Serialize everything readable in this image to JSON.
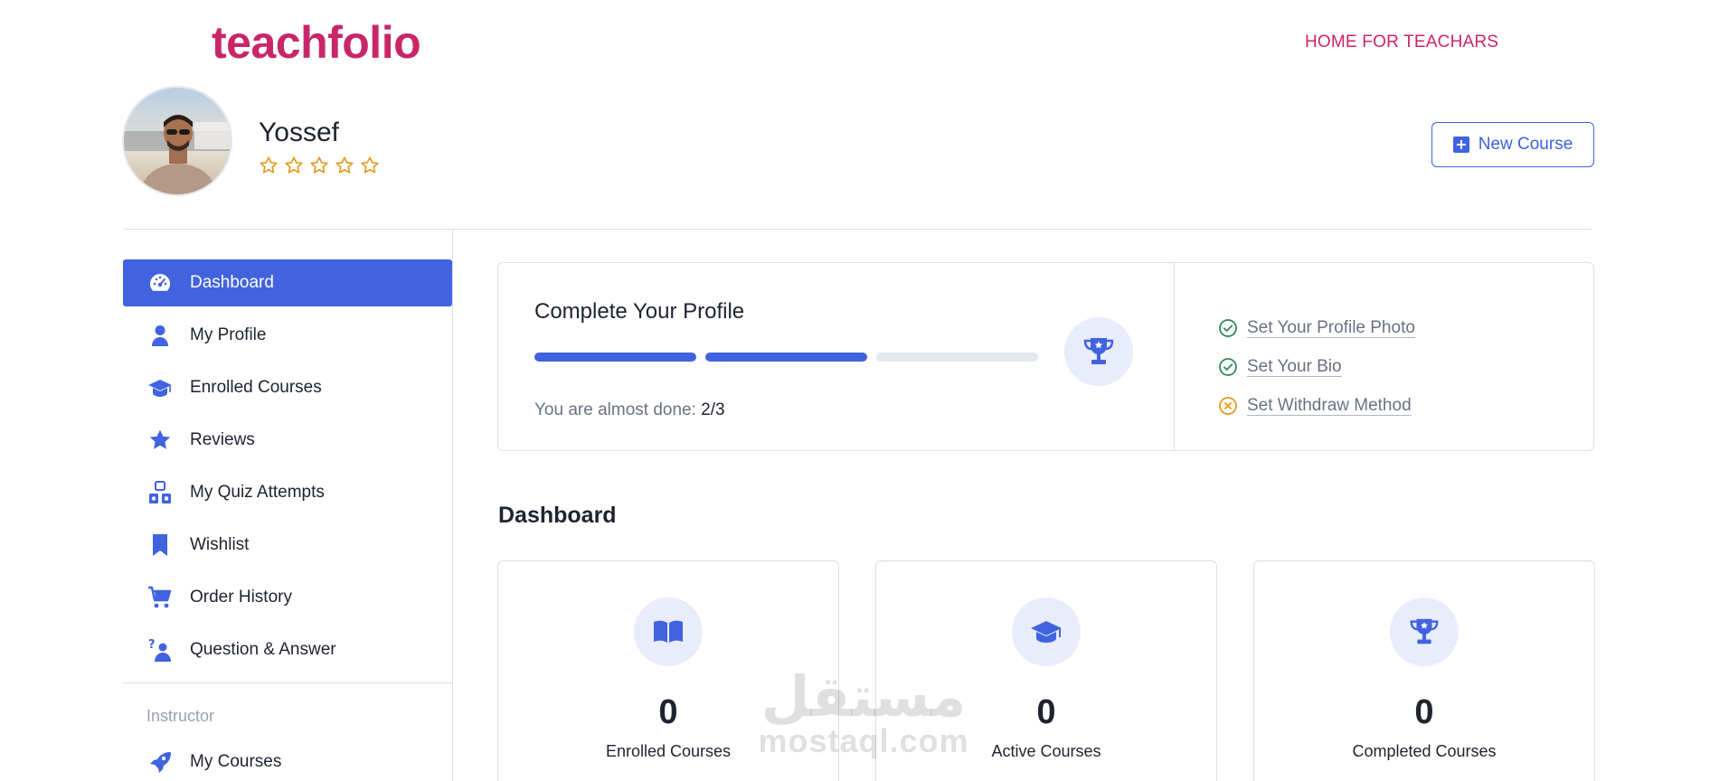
{
  "header": {
    "brand": "teachfolio",
    "top_link": "HOME FOR TEACHARS",
    "new_course_label": "New Course"
  },
  "user": {
    "name": "Yossef",
    "rating_stars": 5,
    "rating_filled": 0
  },
  "sidebar": {
    "items": [
      {
        "label": "Dashboard",
        "icon": "dashboard-gauge-icon",
        "active": true
      },
      {
        "label": "My Profile",
        "icon": "user-icon",
        "active": false
      },
      {
        "label": "Enrolled Courses",
        "icon": "graduation-cap-icon",
        "active": false
      },
      {
        "label": "Reviews",
        "icon": "star-icon",
        "active": false
      },
      {
        "label": "My Quiz Attempts",
        "icon": "shapes-quiz-icon",
        "active": false
      },
      {
        "label": "Wishlist",
        "icon": "bookmark-icon",
        "active": false
      },
      {
        "label": "Order History",
        "icon": "cart-icon",
        "active": false
      },
      {
        "label": "Question & Answer",
        "icon": "question-person-icon",
        "active": false
      }
    ],
    "instructor_heading": "Instructor",
    "instructor_items": [
      {
        "label": "My Courses",
        "icon": "rocket-icon"
      }
    ]
  },
  "profile_card": {
    "title": "Complete Your Profile",
    "progress_steps_total": 3,
    "progress_steps_done": 2,
    "subtitle_prefix": "You are almost done:",
    "subtitle_value": "2/3",
    "checklist": [
      {
        "label": "Set Your Profile Photo",
        "status": "done"
      },
      {
        "label": "Set Your Bio",
        "status": "done"
      },
      {
        "label": "Set Withdraw Method",
        "status": "pending"
      }
    ]
  },
  "dashboard": {
    "title": "Dashboard",
    "stats": [
      {
        "label": "Enrolled Courses",
        "value": "0",
        "icon": "book-open-icon"
      },
      {
        "label": "Active Courses",
        "value": "0",
        "icon": "graduation-cap-icon"
      },
      {
        "label": "Completed Courses",
        "value": "0",
        "icon": "trophy-icon"
      }
    ]
  },
  "watermark": {
    "arabic": "مستقل",
    "latin": "mostaql.com"
  },
  "colors": {
    "brand": "#c9266a",
    "accent": "#4163df",
    "done": "#2e8b57",
    "pending": "#e39a1f",
    "star": "#e39a1f"
  }
}
